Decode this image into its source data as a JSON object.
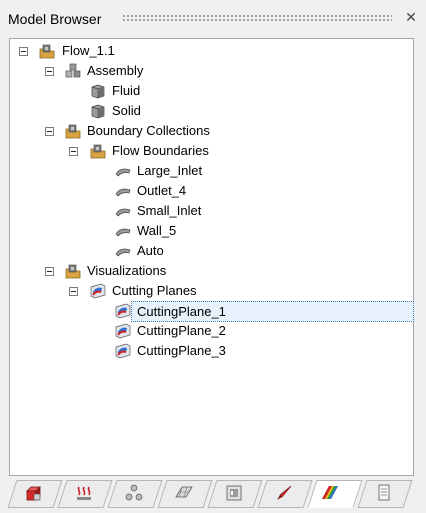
{
  "panel": {
    "title": "Model Browser",
    "close_glyph": "✕"
  },
  "tree": [
    {
      "label": "Flow_1.1",
      "icon": "flow-model-icon",
      "expanded": true
    },
    {
      "label": "Assembly",
      "icon": "assembly-icon",
      "expanded": true
    },
    {
      "label": "Fluid",
      "icon": "solid-body-icon"
    },
    {
      "label": "Solid",
      "icon": "solid-body-icon"
    },
    {
      "label": "Boundary Collections",
      "icon": "boundary-folder-icon",
      "expanded": true
    },
    {
      "label": "Flow Boundaries",
      "icon": "boundary-folder-icon",
      "expanded": true
    },
    {
      "label": "Large_Inlet",
      "icon": "boundary-surface-icon"
    },
    {
      "label": "Outlet_4",
      "icon": "boundary-surface-icon"
    },
    {
      "label": "Small_Inlet",
      "icon": "boundary-surface-icon"
    },
    {
      "label": "Wall_5",
      "icon": "boundary-surface-icon"
    },
    {
      "label": "Auto",
      "icon": "boundary-surface-icon"
    },
    {
      "label": "Visualizations",
      "icon": "visualization-folder-icon",
      "expanded": true
    },
    {
      "label": "Cutting Planes",
      "icon": "cutting-plane-icon",
      "expanded": true
    },
    {
      "label": "CuttingPlane_1",
      "icon": "cutting-plane-icon",
      "selected": true
    },
    {
      "label": "CuttingPlane_2",
      "icon": "cutting-plane-icon"
    },
    {
      "label": "CuttingPlane_3",
      "icon": "cutting-plane-icon"
    }
  ],
  "tabs": [
    {
      "icon": "geometry-tab-icon"
    },
    {
      "icon": "heat-flow-tab-icon"
    },
    {
      "icon": "assembly-tab-icon"
    },
    {
      "icon": "surface-tab-icon"
    },
    {
      "icon": "material-tab-icon"
    },
    {
      "icon": "boundary-tab-icon"
    },
    {
      "icon": "contour-tab-icon",
      "active": true
    },
    {
      "icon": "report-tab-icon"
    }
  ],
  "colors": {
    "selection_border": "#3c7fb1",
    "selection_fill": "#e6f1fb",
    "tree_background": "#ffffff",
    "panel_background": "#f0f0f0"
  }
}
